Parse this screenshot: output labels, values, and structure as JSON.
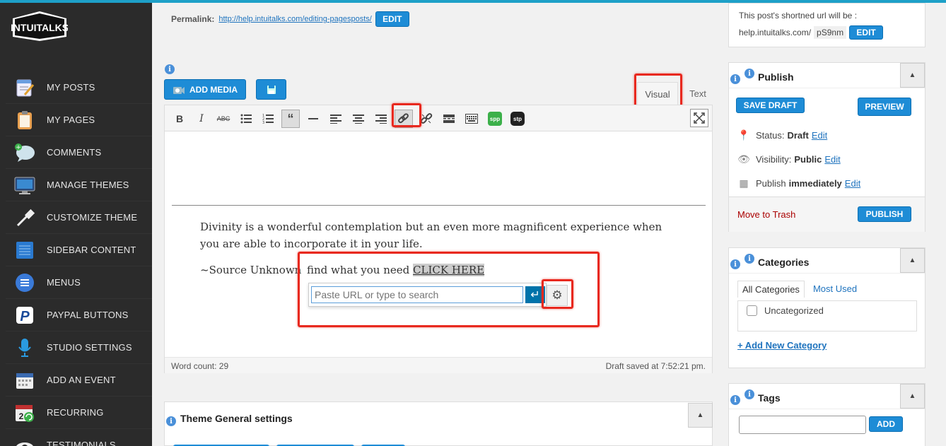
{
  "brand": {
    "logo_text": "INTUITALKS",
    "accent": "#1e8cd6",
    "highlight": "#e8281e"
  },
  "sidebar": {
    "items": [
      {
        "label": "MY POSTS",
        "icon": "notepad-pencil-icon"
      },
      {
        "label": "MY PAGES",
        "icon": "clipboard-icon"
      },
      {
        "label": "COMMENTS",
        "icon": "speech-bubble-icon"
      },
      {
        "label": "MANAGE THEMES",
        "icon": "monitor-icon"
      },
      {
        "label": "CUSTOMIZE THEME",
        "icon": "eyedropper-icon"
      },
      {
        "label": "SIDEBAR CONTENT",
        "icon": "grid-panel-icon"
      },
      {
        "label": "MENUS",
        "icon": "hamburger-menu-icon"
      },
      {
        "label": "PAYPAL BUTTONS",
        "icon": "paypal-icon"
      },
      {
        "label": "STUDIO SETTINGS",
        "icon": "microphone-icon"
      },
      {
        "label": "ADD AN EVENT",
        "icon": "calendar-icon"
      },
      {
        "label": "RECURRING",
        "icon": "calendar-recurring-icon"
      },
      {
        "label": "TESTIMONIALS",
        "icon": "eye-icon"
      }
    ]
  },
  "permalink": {
    "label": "Permalink:",
    "url": "http://help.intuitalks.com/editing-pagesposts/",
    "edit_label": "EDIT"
  },
  "editor": {
    "add_media_label": "ADD MEDIA",
    "tab_visual": "Visual",
    "tab_text": "Text",
    "paragraph": "Divinity is a wonderful contemplation but an even more magnificent experience when you are able to incorporate it in your life.",
    "source": "~Source Unknown",
    "find_text": "find what you need",
    "link_text": "CLICK HERE",
    "link_placeholder": "Paste URL or type to search",
    "word_count": "Word count: 29",
    "draft_saved": "Draft saved at 7:52:21 pm.",
    "toolbar_icons": [
      "bold-icon",
      "italic-icon",
      "strikethrough-icon",
      "bullet-list-icon",
      "numbered-list-icon",
      "blockquote-icon",
      "horizontal-rule-icon",
      "align-left-icon",
      "align-center-icon",
      "align-right-icon",
      "insert-link-icon",
      "unlink-icon",
      "read-more-icon",
      "toolbar-toggle-icon",
      "spp-icon",
      "stp-icon",
      "fullscreen-icon"
    ]
  },
  "theme_settings": {
    "title": "Theme General settings"
  },
  "short_url": {
    "line1": "This post's shortned url will be :",
    "prefix": "help.intuitalks.com/",
    "code": "pS9nm",
    "edit_label": "EDIT"
  },
  "publish": {
    "title": "Publish",
    "save_draft": "SAVE DRAFT",
    "preview": "PREVIEW",
    "status_label": "Status:",
    "status_value": "Draft",
    "visibility_label": "Visibility:",
    "visibility_value": "Public",
    "publish_label": "Publish",
    "publish_value": "immediately",
    "edit_link": "Edit",
    "trash": "Move to Trash",
    "publish_button": "PUBLISH"
  },
  "categories": {
    "title": "Categories",
    "tab_all": "All Categories",
    "tab_most": "Most Used",
    "items": [
      "Uncategorized"
    ],
    "add_new": "+ Add New Category"
  },
  "tags": {
    "title": "Tags",
    "add_label": "ADD"
  }
}
